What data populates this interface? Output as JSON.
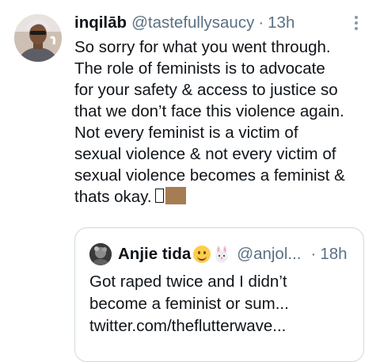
{
  "tweet": {
    "display_name": "inqilāb",
    "handle": "@tastefullysaucy",
    "separator": "·",
    "time": "13h",
    "avatar_icon": "profile-photo",
    "more_icon": "vertical-ellipsis-icon",
    "text": "So sorry for what you went through. The role of feminists is to advocate for your safety & access to justice so that we don’t face this violence again. Not every feminist is a victim of sexual violence & not every victim of sexual violence becomes a feminist & thats okay.",
    "text_lines": [
      "So sorry for what you went through.",
      "The role of feminists is to advocate",
      "for your safety & access to justice so",
      "that we don’t face this violence again.",
      "Not every feminist is a victim of",
      "sexual violence & not every victim of",
      "sexual violence becomes a feminist &",
      "thats okay."
    ],
    "trailing_emoji": "unrendered-emoji-glyph",
    "trailing_emoji_color": "#a67c52"
  },
  "quoted_tweet": {
    "display_name": "Anjie tida",
    "name_emojis": [
      "smiling-face-emoji",
      "rabbit-face-emoji"
    ],
    "handle": "@anjol...",
    "separator": "·",
    "time": "18h",
    "text_lines": [
      "Got raped twice and I didn’t",
      "become a feminist or sum...",
      "twitter.com/theflutterwave..."
    ]
  },
  "colors": {
    "text_primary": "#0f1419",
    "text_secondary": "#5b7083",
    "border": "#cfd9de"
  }
}
